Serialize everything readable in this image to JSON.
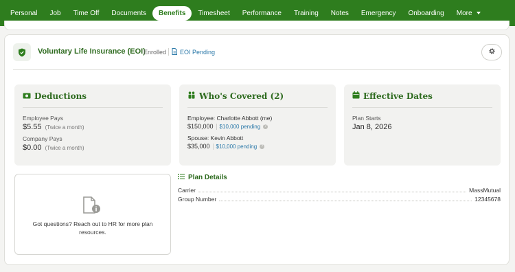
{
  "nav": {
    "tabs": [
      "Personal",
      "Job",
      "Time Off",
      "Documents",
      "Benefits",
      "Timesheet",
      "Performance",
      "Training",
      "Notes",
      "Emergency",
      "Onboarding",
      "More"
    ],
    "active": "Benefits"
  },
  "header": {
    "icon": "shield-icon",
    "title": "Voluntary Life Insurance (EOI)",
    "status": "Enrolled",
    "eoi_label": "EOI Pending"
  },
  "deductions": {
    "title": "Deductions",
    "employee_label": "Employee Pays",
    "employee_amount": "$5.55",
    "employee_freq": "(Twice a month)",
    "company_label": "Company Pays",
    "company_amount": "$0.00",
    "company_freq": "(Twice a month)"
  },
  "covered": {
    "title": "Who's Covered (2)",
    "people": [
      {
        "label": "Employee: Charlotte Abbott (me)",
        "amount": "$150,000",
        "pending": "$10,000 pending"
      },
      {
        "label": "Spouse: Kevin Abbott",
        "amount": "$35,000",
        "pending": "$10,000 pending"
      }
    ]
  },
  "dates": {
    "title": "Effective Dates",
    "label": "Plan Starts",
    "value": "Jan 8, 2026"
  },
  "help": {
    "text": "Got questions? Reach out to HR for more plan resources."
  },
  "plan_details": {
    "title": "Plan Details",
    "rows": [
      {
        "key": "Carrier",
        "value": "MassMutual"
      },
      {
        "key": "Group Number",
        "value": "12345678"
      }
    ]
  },
  "colors": {
    "brand_green": "#2e7d1e",
    "title_green": "#2e6b1f",
    "link_blue": "#2a78a8"
  }
}
